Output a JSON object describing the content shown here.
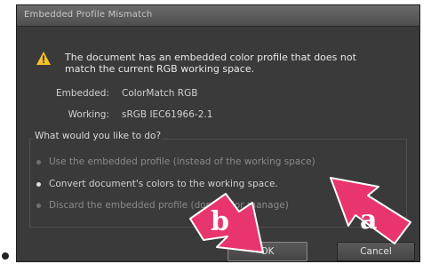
{
  "dialog": {
    "title": "Embedded Profile Mismatch",
    "message_line1": "The document has an embedded color profile that does not",
    "message_line2": "match the current RGB working space.",
    "embedded_label": "Embedded:",
    "embedded_value": "ColorMatch RGB",
    "working_label": "Working:",
    "working_value": "sRGB IEC61966-2.1",
    "question": "What would you like to do?",
    "options": [
      {
        "label": "Use the embedded profile (instead of the working space)",
        "selected": false
      },
      {
        "label": "Convert document's colors to the working space.",
        "selected": true
      },
      {
        "label": "Discard the embedded profile (don't color manage)",
        "selected": false
      }
    ],
    "ok_label": "OK",
    "cancel_label": "Cancel"
  },
  "annotations": {
    "callout_a": "a",
    "callout_b": "b",
    "arrow_color": "#e8356d"
  }
}
